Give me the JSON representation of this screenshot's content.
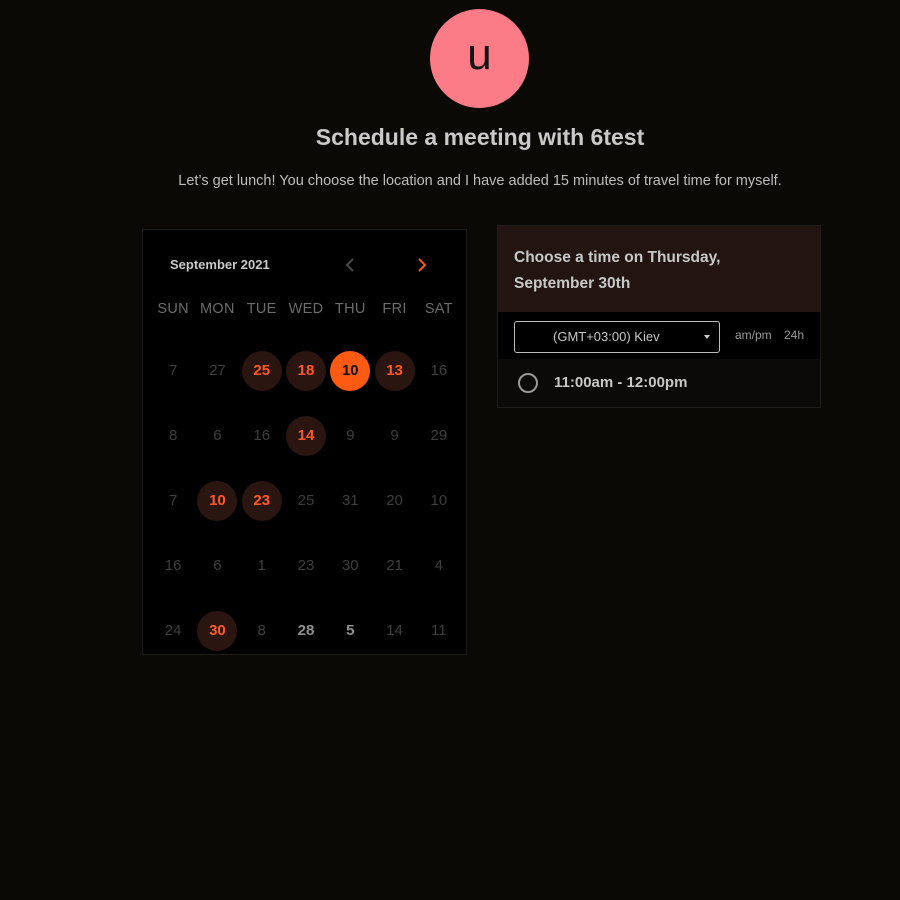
{
  "avatar": {
    "initial": "u",
    "color": "#fb7c86"
  },
  "header": {
    "title": "Schedule a meeting with 6test",
    "subtitle": "Let’s get lunch! You choose the location and I have added 15 minutes of travel time for myself."
  },
  "calendar": {
    "month_label": "September 2021",
    "prev_icon": "chevron-left-icon",
    "next_icon": "chevron-right-icon",
    "weekdays": [
      "SUN",
      "MON",
      "TUE",
      "WED",
      "THU",
      "FRI",
      "SAT"
    ],
    "weeks": [
      [
        {
          "label": "7",
          "state": "disabled"
        },
        {
          "label": "27",
          "state": "disabled"
        },
        {
          "label": "25",
          "state": "available"
        },
        {
          "label": "18",
          "state": "available"
        },
        {
          "label": "10",
          "state": "selected"
        },
        {
          "label": "13",
          "state": "available"
        },
        {
          "label": "16",
          "state": "disabled"
        }
      ],
      [
        {
          "label": "8",
          "state": "disabled"
        },
        {
          "label": "6",
          "state": "disabled"
        },
        {
          "label": "16",
          "state": "disabled"
        },
        {
          "label": "14",
          "state": "available"
        },
        {
          "label": "9",
          "state": "disabled"
        },
        {
          "label": "9",
          "state": "disabled"
        },
        {
          "label": "29",
          "state": "disabled"
        }
      ],
      [
        {
          "label": "7",
          "state": "disabled"
        },
        {
          "label": "10",
          "state": "available"
        },
        {
          "label": "23",
          "state": "available"
        },
        {
          "label": "25",
          "state": "disabled"
        },
        {
          "label": "31",
          "state": "disabled"
        },
        {
          "label": "20",
          "state": "disabled"
        },
        {
          "label": "10",
          "state": "disabled"
        }
      ],
      [
        {
          "label": "16",
          "state": "disabled"
        },
        {
          "label": "6",
          "state": "disabled"
        },
        {
          "label": "1",
          "state": "disabled"
        },
        {
          "label": "23",
          "state": "disabled"
        },
        {
          "label": "30",
          "state": "disabled"
        },
        {
          "label": "21",
          "state": "disabled"
        },
        {
          "label": "4",
          "state": "disabled"
        }
      ],
      [
        {
          "label": "24",
          "state": "disabled"
        },
        {
          "label": "30",
          "state": "available"
        },
        {
          "label": "8",
          "state": "disabled"
        },
        {
          "label": "28",
          "state": "bright"
        },
        {
          "label": "5",
          "state": "bright"
        },
        {
          "label": "14",
          "state": "disabled"
        },
        {
          "label": "11",
          "state": "disabled"
        }
      ]
    ]
  },
  "time_panel": {
    "heading": "Choose a time on Thursday, September 30th",
    "timezone": {
      "value": "(GMT+03:00) Kiev",
      "icon": "caret-down-icon"
    },
    "format_options": [
      "am/pm",
      "24h"
    ],
    "slots": [
      "11:00am - 12:00pm"
    ]
  },
  "colors": {
    "accent": "#ff5a12",
    "accent_text": "#ff5a1f",
    "available_bg": "#2a1510",
    "background": "#0b0906",
    "header_bg": "#221410"
  }
}
